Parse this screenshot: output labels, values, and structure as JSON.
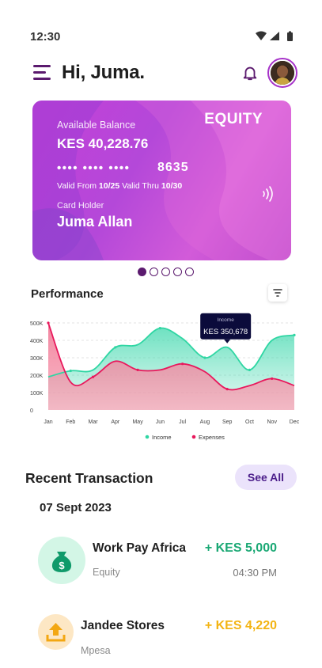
{
  "status_bar": {
    "time": "12:30",
    "icons": [
      "wifi-icon",
      "signal-icon",
      "battery-icon"
    ]
  },
  "header": {
    "greeting": "Hi, Juma."
  },
  "card": {
    "bank": "EQUITY",
    "balance_label": "Available Balance",
    "balance": "KES 40,228.76",
    "masked_number": "•••• •••• ••••",
    "last4": "8635",
    "valid_from_label": "Valid From",
    "valid_from": "10/25",
    "valid_thru_label": "Valid Thru",
    "valid_thru": "10/30",
    "holder_label": "Card Holder",
    "holder": "Juma Allan"
  },
  "carousel": {
    "count": 5,
    "active": 0
  },
  "performance": {
    "title": "Performance"
  },
  "chart_data": {
    "type": "area",
    "categories": [
      "Jan",
      "Feb",
      "Mar",
      "Apr",
      "May",
      "Jun",
      "Jul",
      "Aug",
      "Sep",
      "Oct",
      "Nov",
      "Dec"
    ],
    "y_ticks": [
      "0",
      "100K",
      "200K",
      "300K",
      "400K",
      "500K"
    ],
    "ylim": [
      0,
      500000
    ],
    "grid": "horizontal dashed",
    "legend_position": "bottom",
    "series": [
      {
        "name": "Income",
        "color": "#2fd6a3",
        "values": [
          190000,
          225000,
          230000,
          360000,
          375000,
          470000,
          410000,
          300000,
          360000,
          230000,
          400000,
          430000
        ]
      },
      {
        "name": "Expenses",
        "color": "#e8185c",
        "values": [
          500000,
          160000,
          190000,
          280000,
          230000,
          230000,
          265000,
          220000,
          120000,
          140000,
          180000,
          140000
        ]
      }
    ],
    "tooltip": {
      "label": "Income",
      "value": "KES 350,678",
      "category": "Sep"
    }
  },
  "transactions": {
    "title": "Recent Transaction",
    "see_all": "See All",
    "date": "07 Sept 2023",
    "items": [
      {
        "name": "Work Pay Africa",
        "source": "Equity",
        "amount": "+ KES 5,000",
        "time": "04:30 PM",
        "icon": "money-bag-icon",
        "amount_color": "#1aa874"
      },
      {
        "name": "Jandee Stores",
        "source": "Mpesa",
        "amount": "+ KES 4,220",
        "time": "",
        "icon": "upload-tray-icon",
        "amount_color": "#f3b414"
      }
    ]
  }
}
